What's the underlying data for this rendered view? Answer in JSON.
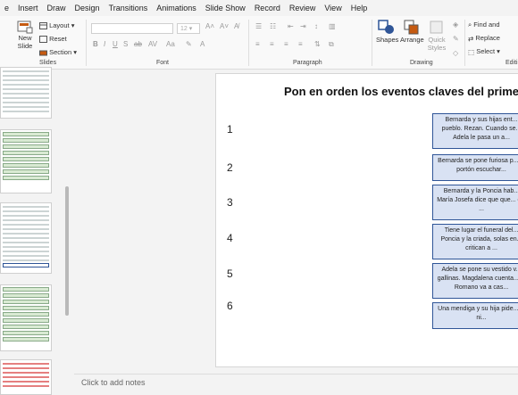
{
  "menu": {
    "tabs": [
      "e",
      "Insert",
      "Draw",
      "Design",
      "Transitions",
      "Animations",
      "Slide Show",
      "Record",
      "Review",
      "View",
      "Help"
    ]
  },
  "ribbon": {
    "slides_group": {
      "new_slide_label": "New",
      "new_slide_label2": "Slide",
      "layout_label": "Layout",
      "reset_label": "Reset",
      "section_label": "Section",
      "group_label": "Slides"
    },
    "font_group": {
      "group_label": "Font",
      "size_value": "12"
    },
    "paragraph_group": {
      "group_label": "Paragraph"
    },
    "drawing_group": {
      "shapes_label": "Shapes",
      "arrange_label": "Arrange",
      "quick_styles_label": "Quick",
      "quick_styles_label2": "Styles",
      "group_label": "Drawing"
    },
    "editing_group": {
      "find_label": "Find and",
      "replace_label": "Replace",
      "select_label": "Select",
      "group_label": "Editi"
    }
  },
  "slide": {
    "title": "Pon en orden los eventos claves del primer",
    "numbers": [
      "1",
      "2",
      "3",
      "4",
      "5",
      "6"
    ],
    "events": [
      "Bernarda y sus hijas ent... pueblo. Rezan. Cuando se... Adela le pasa un a...",
      "Bernarda se pone furiosa p... al portón escuchar...",
      "Bernarda y la Poncia hab... María Josefa dice que que... del ...",
      "Tiene lugar el funeral del... Poncia y la criada, solas en... critican a ...",
      "Adela se pone su vestido v... gallinas. Magdalena cuenta... el Romano va a cas...",
      "Una mendiga y su hija pide... la ni..."
    ]
  },
  "notes": {
    "placeholder": "Click to add notes"
  },
  "colors": {
    "event_fill": "#d9e2f3",
    "event_border": "#2f5597"
  }
}
